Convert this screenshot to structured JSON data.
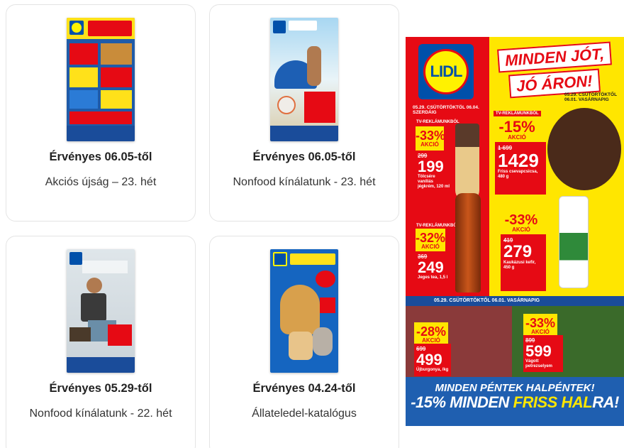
{
  "cards": [
    {
      "valid": "Érvényes 06.05-től",
      "name": "Akciós újság – 23. hét"
    },
    {
      "valid": "Érvényes 06.05-től",
      "name": "Nonfood kínálatunk - 23. hét"
    },
    {
      "valid": "Érvényes 05.29-től",
      "name": "Nonfood kínálatunk - 22. hét"
    },
    {
      "valid": "Érvényes 04.24-től",
      "name": "Állateledel-katalógus"
    }
  ],
  "banner": {
    "logo": "LIDL",
    "slogan_1": "MINDEN JÓT,",
    "slogan_2": "JÓ ÁRON!",
    "period_left": "05.29. CSÜTÖRTÖKTÖL 06.04. SZERDÁIG",
    "period_right": "05.29. CSÜTÖRTÖKTŐL 06.01. VASÁRNAPIG",
    "offers": [
      {
        "pct": "-33%",
        "label": "AKCIÓ",
        "old": "299",
        "new": "199",
        "desc": "Tölcsére vaníliás jégkrém, 120 ml"
      },
      {
        "pct": "-15%",
        "label": "AKCIÓ",
        "old": "1 699",
        "new": "1429",
        "desc": "Friss csevapcsicsa, 480 g"
      },
      {
        "pct": "-32%",
        "label": "AKCIÓ",
        "old": "369",
        "new": "249",
        "desc": "Jeges tea, 1,5 l"
      },
      {
        "pct": "-33%",
        "label": "AKCIÓ",
        "old": "419",
        "new": "279",
        "desc": "Kaukázusi kefír, 450 g"
      },
      {
        "pct": "-28%",
        "label": "AKCIÓ",
        "old": "699",
        "new": "499",
        "desc": "Újburgonya, /kg"
      },
      {
        "pct": "-33%",
        "label": "AKCIÓ",
        "old": "899",
        "new": "599",
        "desc": "Vágott petrezselyem"
      }
    ],
    "tv_label": "TV-REKLÁMUNKBÓL",
    "mid_strip": "05.29. CSÜTÖRTÖKTŐL 06.01. VASÁRNAPIG",
    "friday_1": "MINDEN PÉNTEK HALPÉNTEK!",
    "friday_2a": "-15% MINDEN ",
    "friday_2b": "FRISS HAL",
    "friday_2c": "RA!"
  },
  "colors": {
    "lidl_blue": "#0050aa",
    "lidl_yellow": "#ffe600",
    "lidl_red": "#e60a14"
  }
}
